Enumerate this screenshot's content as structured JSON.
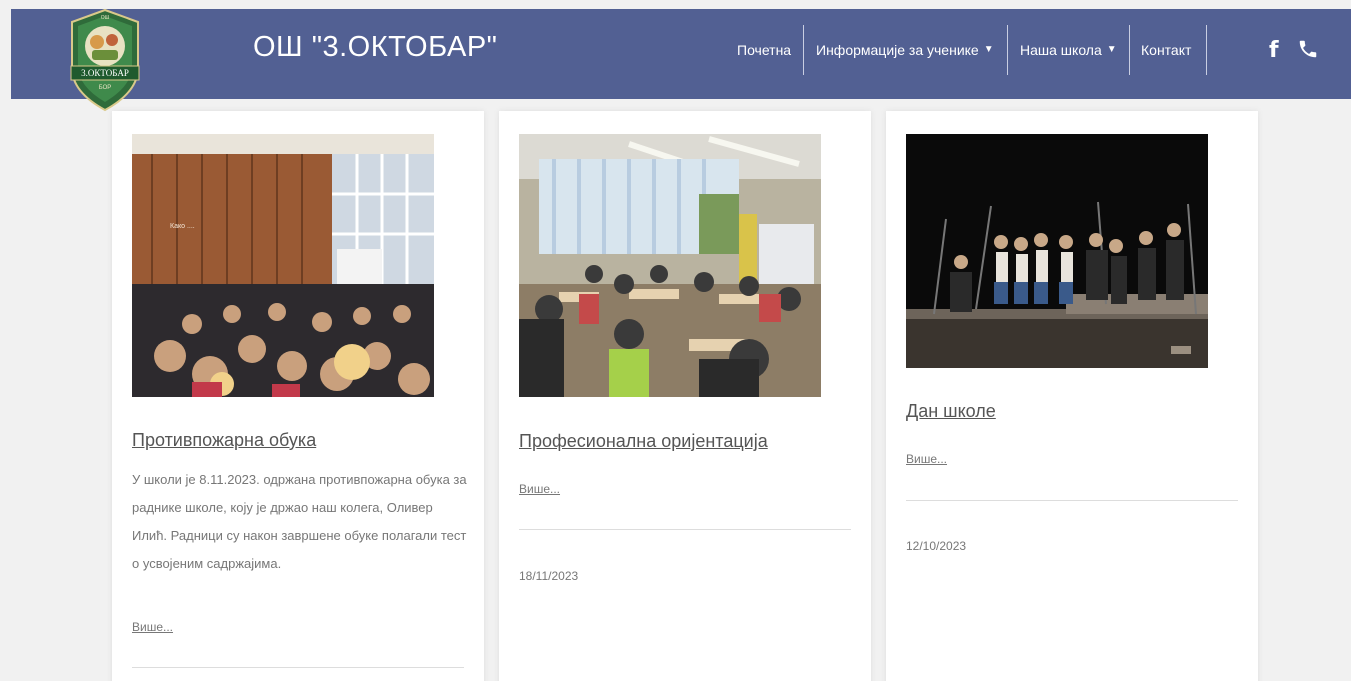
{
  "header": {
    "site_title": "ОШ \"3.ОКТОБАР\"",
    "logo_text": "3.ОКТОБАР",
    "logo_sub": "БОР",
    "logo_top": "ОШ",
    "brand_color": "#526093"
  },
  "nav": {
    "home": "Почетна",
    "students_info": "Информације за ученике",
    "our_school": "Наша школа",
    "contact": "Контакт"
  },
  "social": {
    "facebook_glyph": "f",
    "phone_glyph": "✆",
    "icons": [
      "facebook-icon",
      "phone-icon"
    ]
  },
  "posts": [
    {
      "title": "Противпожарна обука",
      "excerpt": "У школи је 8.11.2023. одржана противпожарна обука за раднике школе, коју је држао наш колега, Оливер Илић. Радници су након завршене обуке полагали тест о усвојеним садржајима.",
      "more": "Више...",
      "date": "",
      "photo_text": "Како ...."
    },
    {
      "title": "Професионална оријентација",
      "excerpt": "",
      "more": "Више...",
      "date": "18/11/2023"
    },
    {
      "title": "Дан школе",
      "excerpt": "",
      "more": "Више...",
      "date": "12/10/2023"
    }
  ]
}
